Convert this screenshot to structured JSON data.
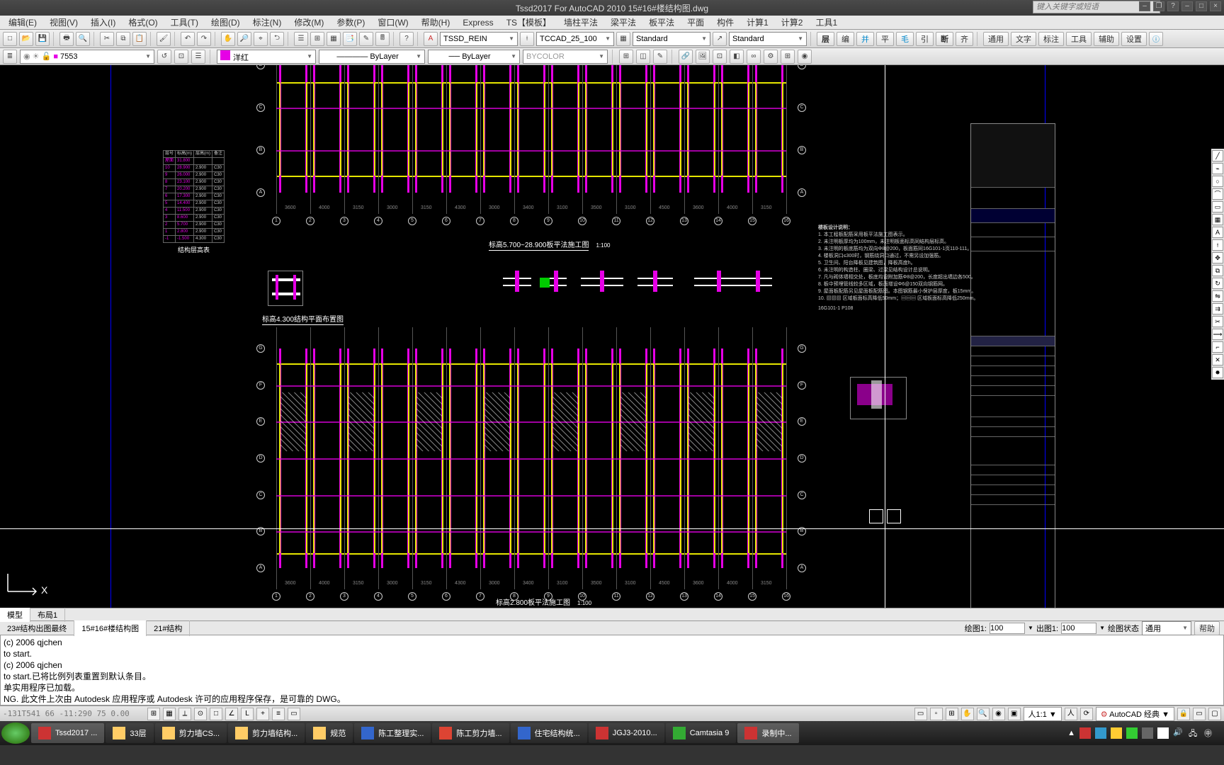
{
  "title": "Tssd2017 For AutoCAD 2010    15#16#楼结构图.dwg",
  "search_placeholder": "键入关键字或短语",
  "menus": [
    "编辑(E)",
    "视图(V)",
    "插入(I)",
    "格式(O)",
    "工具(T)",
    "绘图(D)",
    "标注(N)",
    "修改(M)",
    "参数(P)",
    "窗口(W)",
    "帮助(H)",
    "Express",
    "TS【模板】",
    "墙柱平法",
    "梁平法",
    "板平法",
    "平面",
    "构件",
    "计算1",
    "计算2",
    "工具1"
  ],
  "row1": {
    "combos": {
      "style1": "TSSD_REIN",
      "style2": "TCCAD_25_100",
      "std1": "Standard",
      "std2": "Standard"
    },
    "textbtns": [
      "层",
      "编",
      "并",
      "平",
      "毛",
      "引",
      "断",
      "齐"
    ],
    "right": [
      "通用",
      "文字",
      "标注",
      "工具",
      "辅助",
      "设置"
    ]
  },
  "layerrow": {
    "layer": "7553",
    "color": "洋红",
    "ltype": "ByLayer",
    "lweight": "ByLayer",
    "plot": "BYCOLOR"
  },
  "drawing": {
    "upper_title": "标高5.700~28.900板平法施工图",
    "upper_scale": "1:100",
    "mid_title": "标高4.300结构平面布置图",
    "lower_title": "标高2.800板平法施工图",
    "lower_scale": "1:100",
    "schedule_title": "结构层高表",
    "schedule_cols": [
      "层号",
      "标高(m)",
      "层高(m)",
      "备注"
    ],
    "schedule_rows": [
      [
        "屋面",
        "31.800",
        "",
        ""
      ],
      [
        "10",
        "28.900",
        "2.900",
        "C30"
      ],
      [
        "9",
        "26.000",
        "2.900",
        "C30"
      ],
      [
        "8",
        "23.100",
        "2.900",
        "C30"
      ],
      [
        "7",
        "20.200",
        "2.900",
        "C30"
      ],
      [
        "6",
        "17.300",
        "2.900",
        "C30"
      ],
      [
        "5",
        "14.400",
        "2.900",
        "C30"
      ],
      [
        "4",
        "11.500",
        "2.900",
        "C30"
      ],
      [
        "3",
        "8.600",
        "2.900",
        "C30"
      ],
      [
        "2",
        "5.700",
        "2.900",
        "C30"
      ],
      [
        "1",
        "2.800",
        "2.900",
        "C30"
      ],
      [
        "-1",
        "-1.500",
        "4.300",
        "C30"
      ]
    ],
    "notes_header": "楼板设计说明：",
    "notes": [
      "1. 本工程板配筋采用板平法施工图表示。",
      "2. 未注明板厚均为100mm，未注明板面标高同结构层标高。",
      "3. 未注明的板底筋均为双向Φ8@200，板面筋同16G101-1页110-111。",
      "4. 楼板洞口≤300时，钢筋绕洞口通过，不需另设加强筋。",
      "5. 卫生间、阳台降板见建筑图，降板高度h。",
      "6. 未注明的构造柱、圈梁、过梁见结构设计总说明。",
      "7. 凡与砌体墙相交处，板底均设附加筋Φ8@200，长度超出墙边各500。",
      "8. 板中预埋管线较多区域，板面增设Φ6@150双向钢筋网。",
      "9. 屋面板配筋另见屋面板配筋图。本图钢筋最小保护层厚度，板15mm。",
      "10. ▨▨▨ 区域板面标高降低50mm；▤▤▤ 区域板面标高降低250mm。"
    ],
    "notes_footer": "16G101-1 P108"
  },
  "layout_tabs": [
    "模型",
    "布局1"
  ],
  "file_tabs": [
    "23#结构出图最终",
    "15#16#楼结构图",
    "21#结构"
  ],
  "scalectl": {
    "l1": "绘图1:",
    "v1": "100",
    "l2": "出图1:",
    "v2": "100",
    "l3": "绘图状态",
    "v3": "通用",
    "help": "帮助"
  },
  "cmdlog": [
    "(c) 2006 qjchen",
    "to start.",
    "(c) 2006 qjchen",
    "to start.已将比例列表重置到默认条目。",
    "单实用程序已加载。",
    "NG.    此文件上次由 Autodesk 应用程序或 Autodesk 许可的应用程序保存，是可靠的 DWG。"
  ],
  "status": {
    "coords": "-131T541 66  -11:290 75  0.00",
    "scale": "1:1",
    "mode": "AutoCAD 经典"
  },
  "taskbar": [
    {
      "name": "Tssd2017 ...",
      "color": "#c33",
      "active": true
    },
    {
      "name": "33层",
      "color": "#fc6"
    },
    {
      "name": "剪力墙CS...",
      "color": "#fc6"
    },
    {
      "name": "剪力墙结构...",
      "color": "#fc6"
    },
    {
      "name": "规范",
      "color": "#fc6"
    },
    {
      "name": "陈工整理实...",
      "color": "#36c"
    },
    {
      "name": "陈工剪力墙...",
      "color": "#d43"
    },
    {
      "name": "住宅结构统...",
      "color": "#36c"
    },
    {
      "name": "JGJ3-2010...",
      "color": "#c33"
    },
    {
      "name": "Camtasia 9",
      "color": "#3a3"
    },
    {
      "name": "录制中...",
      "color": "#c33",
      "active": true
    }
  ]
}
